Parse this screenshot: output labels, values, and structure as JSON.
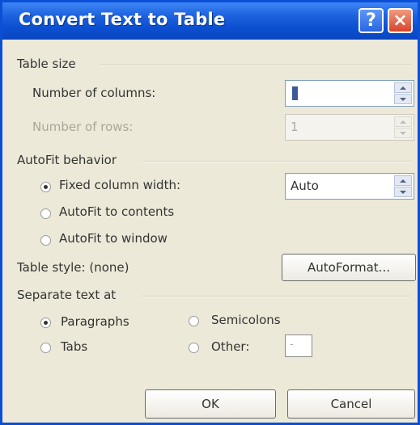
{
  "title": "Convert Text to Table",
  "title_buttons": {
    "help": "?",
    "close": "×"
  },
  "table_size": {
    "heading": "Table size",
    "columns_label": "Number of columns:",
    "columns_value": "1",
    "rows_label": "Number of rows:",
    "rows_value": "1"
  },
  "autofit": {
    "heading": "AutoFit behavior",
    "options": [
      {
        "label": "Fixed column width:",
        "selected": true
      },
      {
        "label": "AutoFit to contents",
        "selected": false
      },
      {
        "label": "AutoFit to window",
        "selected": false
      }
    ],
    "width_value": "Auto"
  },
  "table_style": {
    "label": "Table style: (none)",
    "button": "AutoFormat..."
  },
  "separate": {
    "heading": "Separate text at",
    "paragraphs": "Paragraphs",
    "semicolons": "Semicolons",
    "tabs": "Tabs",
    "other": "Other:",
    "other_value": "-",
    "selected": "Paragraphs"
  },
  "footer": {
    "ok": "OK",
    "cancel": "Cancel"
  }
}
